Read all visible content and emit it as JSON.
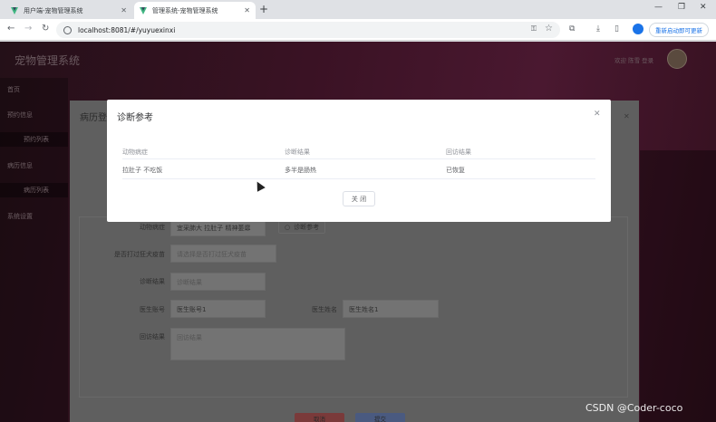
{
  "browser": {
    "tabs": [
      {
        "label": "用户端-宠物管理系统",
        "active": false
      },
      {
        "label": "管理系统-宠物管理系统",
        "active": true
      }
    ],
    "url": "localhost:8081/#/yuyuexinxi",
    "update_button": "重新启动即可更新"
  },
  "app": {
    "title": "宠物管理系统",
    "user": "欢迎 陈雪 登录",
    "sidebar": [
      "首页",
      "预约信息",
      "预约列表",
      "病历信息",
      "病历列表",
      "系统设置"
    ]
  },
  "bg_dialog": {
    "title": "病历登",
    "fields": {
      "symptom_label": "动物病症",
      "symptom_value": "宜采肺大 拉肚子  精神萎靡",
      "reference_button": "诊断参考",
      "vaccine_label": "是否打过狂犬疫苗",
      "vaccine_placeholder": "请选择是否打过狂犬疫苗",
      "diagnosis_label": "诊断结果",
      "diagnosis_placeholder": "诊断结果",
      "doctor_no_label": "医生账号",
      "doctor_no_value": "医生账号1",
      "doctor_name_label": "医生姓名",
      "doctor_name_value": "医生姓名1",
      "followup_label": "回访结果",
      "followup_placeholder": "回访结果"
    },
    "footer": {
      "cancel": "取消",
      "confirm": "提交"
    }
  },
  "modal": {
    "title": "诊断参考",
    "columns": [
      "动物病症",
      "诊断结果",
      "回访结果"
    ],
    "rows": [
      [
        "拉肚子 不吃饭",
        "多半是肠热",
        "已恢复"
      ]
    ],
    "close_button": "关 闭"
  },
  "watermark": "CSDN @Coder-coco"
}
